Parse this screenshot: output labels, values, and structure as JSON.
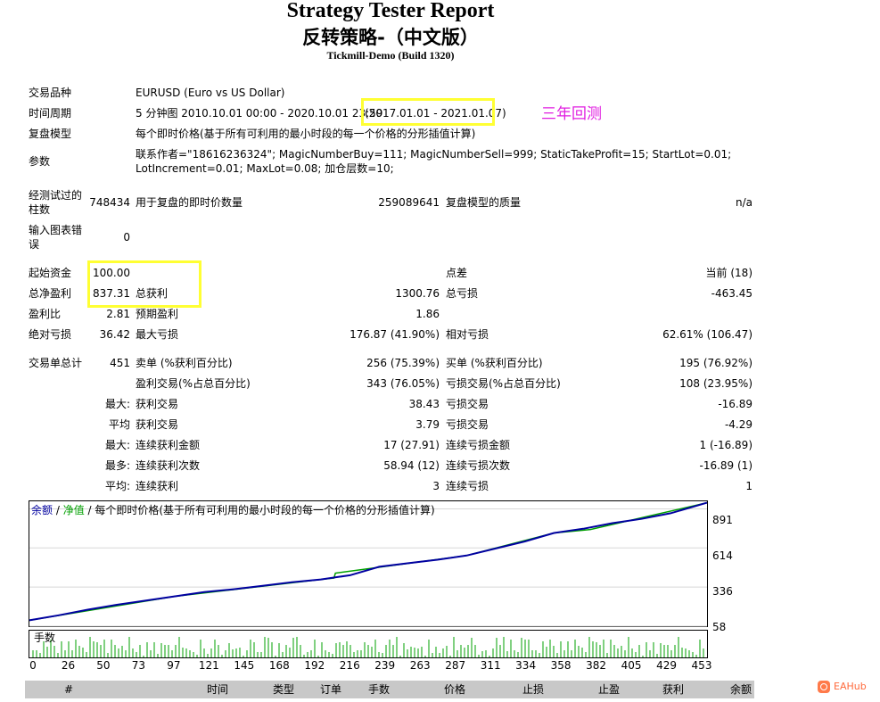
{
  "report": {
    "title": "Strategy Tester Report",
    "subtitle": "反转策略-（中文版）",
    "server": "Tickmill-Demo (Build 1320)"
  },
  "info": {
    "symbol_label": "交易品种",
    "symbol_value": "EURUSD (Euro vs US Dollar)",
    "period_label": "时间周期",
    "period_value": "5 分钟图 2010.10.01 00:00 - 2020.10.01 23:59",
    "period_actual": "(2017.01.01 - 2021.01.07)",
    "model_label": "复盘模型",
    "model_value": "每个即时价格(基于所有可利用的最小时段的每一个价格的分形插值计算)",
    "params_label": "参数",
    "params_line1": "联系作者=\"18616236324\"; MagicNumberBuy=111; MagicNumberSell=999; StaticTakeProfit=15; StartLot=0.01;",
    "params_line2": "LotIncrement=0.01; MaxLot=0.08; 加仓层数=10;",
    "bars_label_1": "经测试过的",
    "bars_label_2": "柱数",
    "bars_value": "748434",
    "ticks_label": "用于复盘的即时价数量",
    "ticks_value": "259089641",
    "quality_label": "复盘模型的质量",
    "quality_value": "n/a",
    "errors_label_1": "输入图表错",
    "errors_label_2": "误",
    "errors_value": "0"
  },
  "annotation": {
    "note": "三年回测",
    "highlight_color": "#ffff33",
    "note_color": "#e01ee0"
  },
  "stats": {
    "deposit_label": "起始资金",
    "deposit_value": "100.00",
    "spread_label": "点差",
    "spread_value": "当前 (18)",
    "net_profit_label": "总净盈利",
    "net_profit_value": "837.31",
    "gross_profit_label": "总获利",
    "gross_profit_value": "1300.76",
    "gross_loss_label": "总亏损",
    "gross_loss_value": "-463.45",
    "profit_factor_label": "盈利比",
    "profit_factor_value": "2.81",
    "expected_payoff_label": "预期盈利",
    "expected_payoff_value": "1.86",
    "abs_drawdown_label": "绝对亏损",
    "abs_drawdown_value": "36.42",
    "max_drawdown_label": "最大亏损",
    "max_drawdown_value": "176.87 (41.90%)",
    "rel_drawdown_label": "相对亏损",
    "rel_drawdown_value": "62.61% (106.47)",
    "total_trades_label": "交易单总计",
    "total_trades_value": "451",
    "short_label": "卖单 (%获利百分比)",
    "short_value": "256 (75.39%)",
    "long_label": "买单 (%获利百分比)",
    "long_value": "195 (76.92%)",
    "profit_trades_label": "盈利交易(%占总百分比)",
    "profit_trades_value": "343 (76.05%)",
    "loss_trades_label": "亏损交易(%占总百分比)",
    "loss_trades_value": "108 (23.95%)",
    "largest_prefix": "最大:",
    "largest_profit_label": "获利交易",
    "largest_profit_value": "38.43",
    "largest_loss_label": "亏损交易",
    "largest_loss_value": "-16.89",
    "average_prefix": "平均",
    "average_profit_label": "获利交易",
    "average_profit_value": "3.79",
    "average_loss_label": "亏损交易",
    "average_loss_value": "-4.29",
    "max_consec_prefix": "最大:",
    "max_consec_wins_label": "连续获利金额",
    "max_consec_wins_value": "17 (27.91)",
    "max_consec_losses_label": "连续亏损金额",
    "max_consec_losses_value": "1 (-16.89)",
    "most_consec_prefix": "最多:",
    "most_consec_profit_label": "连续获利次数",
    "most_consec_profit_value": "58.94 (12)",
    "most_consec_loss_label": "连续亏损次数",
    "most_consec_loss_value": "-16.89 (1)",
    "avg_consec_prefix": "平均:",
    "avg_consec_wins_label": "连续获利",
    "avg_consec_wins_value": "3",
    "avg_consec_losses_label": "连续亏损",
    "avg_consec_losses_value": "1"
  },
  "chart_legend": {
    "balance": "余额",
    "sep1": " / ",
    "equity": "净值",
    "sep2": " / ",
    "model": "每个即时价格(基于所有可利用的最小时段的每一个价格的分形插值计算)"
  },
  "volume_label": "手数",
  "chart_data": {
    "type": "line",
    "ylim": [
      58,
      945
    ],
    "yticks": [
      "891",
      "614",
      "336",
      "58"
    ],
    "xlim": [
      0,
      465
    ],
    "xticks": [
      "0",
      "26",
      "50",
      "73",
      "97",
      "121",
      "145",
      "168",
      "192",
      "216",
      "239",
      "263",
      "287",
      "311",
      "334",
      "358",
      "382",
      "405",
      "429",
      "453"
    ],
    "series": [
      {
        "name": "余额",
        "color": "#0000a0",
        "x": [
          0,
          20,
          40,
          60,
          80,
          100,
          120,
          140,
          160,
          180,
          200,
          220,
          240,
          260,
          280,
          300,
          320,
          340,
          360,
          380,
          400,
          420,
          440,
          465
        ],
        "values": [
          100,
          135,
          175,
          210,
          240,
          270,
          300,
          320,
          345,
          370,
          390,
          420,
          480,
          505,
          530,
          560,
          610,
          660,
          720,
          750,
          790,
          820,
          860,
          935
        ]
      },
      {
        "name": "净值",
        "color": "#00a000",
        "x": [
          0,
          100,
          200,
          209,
          210,
          300,
          360,
          385,
          465
        ],
        "values": [
          100,
          270,
          390,
          400,
          435,
          560,
          720,
          745,
          935
        ]
      }
    ],
    "volume_color": "#00a000"
  },
  "table_header": [
    "#",
    "时间",
    "类型",
    "订单",
    "手数",
    "价格",
    "止损",
    "止盈",
    "获利",
    "余额"
  ],
  "watermark": "EAHub"
}
